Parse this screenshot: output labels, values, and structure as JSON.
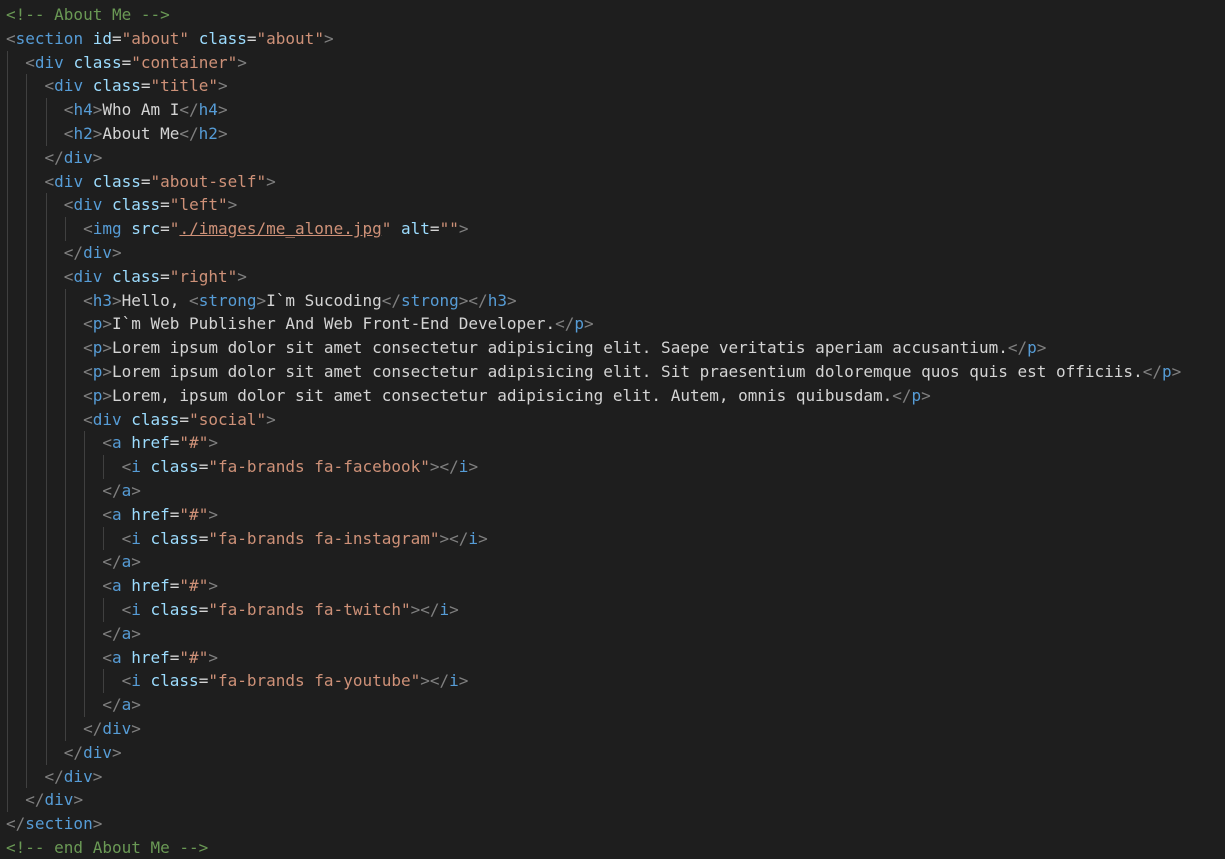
{
  "colors": {
    "background": "#1e1e1e",
    "comment": "#6a9955",
    "bracket": "#808080",
    "tag": "#569cd6",
    "attribute": "#9cdcfe",
    "string": "#ce9178",
    "text": "#d4d4d4",
    "indent_guide": "#404040"
  },
  "editor": {
    "indent_chars": 2,
    "lines": [
      {
        "indent": 0,
        "tokens": [
          {
            "t": "c",
            "v": "<!-- About Me -->"
          }
        ]
      },
      {
        "indent": 0,
        "tokens": [
          {
            "t": "b",
            "v": "<"
          },
          {
            "t": "g",
            "v": "section"
          },
          {
            "t": "x",
            "v": " "
          },
          {
            "t": "a",
            "v": "id"
          },
          {
            "t": "x",
            "v": "="
          },
          {
            "t": "s",
            "v": "\"about\""
          },
          {
            "t": "x",
            "v": " "
          },
          {
            "t": "a",
            "v": "class"
          },
          {
            "t": "x",
            "v": "="
          },
          {
            "t": "s",
            "v": "\"about\""
          },
          {
            "t": "b",
            "v": ">"
          }
        ]
      },
      {
        "indent": 1,
        "tokens": [
          {
            "t": "b",
            "v": "<"
          },
          {
            "t": "g",
            "v": "div"
          },
          {
            "t": "x",
            "v": " "
          },
          {
            "t": "a",
            "v": "class"
          },
          {
            "t": "x",
            "v": "="
          },
          {
            "t": "s",
            "v": "\"container\""
          },
          {
            "t": "b",
            "v": ">"
          }
        ]
      },
      {
        "indent": 2,
        "tokens": [
          {
            "t": "b",
            "v": "<"
          },
          {
            "t": "g",
            "v": "div"
          },
          {
            "t": "x",
            "v": " "
          },
          {
            "t": "a",
            "v": "class"
          },
          {
            "t": "x",
            "v": "="
          },
          {
            "t": "s",
            "v": "\"title\""
          },
          {
            "t": "b",
            "v": ">"
          }
        ]
      },
      {
        "indent": 3,
        "tokens": [
          {
            "t": "b",
            "v": "<"
          },
          {
            "t": "g",
            "v": "h4"
          },
          {
            "t": "b",
            "v": ">"
          },
          {
            "t": "x",
            "v": "Who Am I"
          },
          {
            "t": "b",
            "v": "</"
          },
          {
            "t": "g",
            "v": "h4"
          },
          {
            "t": "b",
            "v": ">"
          }
        ]
      },
      {
        "indent": 3,
        "tokens": [
          {
            "t": "b",
            "v": "<"
          },
          {
            "t": "g",
            "v": "h2"
          },
          {
            "t": "b",
            "v": ">"
          },
          {
            "t": "x",
            "v": "About Me"
          },
          {
            "t": "b",
            "v": "</"
          },
          {
            "t": "g",
            "v": "h2"
          },
          {
            "t": "b",
            "v": ">"
          }
        ]
      },
      {
        "indent": 2,
        "tokens": [
          {
            "t": "b",
            "v": "</"
          },
          {
            "t": "g",
            "v": "div"
          },
          {
            "t": "b",
            "v": ">"
          }
        ]
      },
      {
        "indent": 2,
        "tokens": [
          {
            "t": "b",
            "v": "<"
          },
          {
            "t": "g",
            "v": "div"
          },
          {
            "t": "x",
            "v": " "
          },
          {
            "t": "a",
            "v": "class"
          },
          {
            "t": "x",
            "v": "="
          },
          {
            "t": "s",
            "v": "\"about-self\""
          },
          {
            "t": "b",
            "v": ">"
          }
        ]
      },
      {
        "indent": 3,
        "tokens": [
          {
            "t": "b",
            "v": "<"
          },
          {
            "t": "g",
            "v": "div"
          },
          {
            "t": "x",
            "v": " "
          },
          {
            "t": "a",
            "v": "class"
          },
          {
            "t": "x",
            "v": "="
          },
          {
            "t": "s",
            "v": "\"left\""
          },
          {
            "t": "b",
            "v": ">"
          }
        ]
      },
      {
        "indent": 4,
        "tokens": [
          {
            "t": "b",
            "v": "<"
          },
          {
            "t": "g",
            "v": "img"
          },
          {
            "t": "x",
            "v": " "
          },
          {
            "t": "a",
            "v": "src"
          },
          {
            "t": "x",
            "v": "="
          },
          {
            "t": "s",
            "v": "\""
          },
          {
            "t": "u",
            "v": "./images/me_alone.jpg"
          },
          {
            "t": "s",
            "v": "\""
          },
          {
            "t": "x",
            "v": " "
          },
          {
            "t": "a",
            "v": "alt"
          },
          {
            "t": "x",
            "v": "="
          },
          {
            "t": "s",
            "v": "\"\""
          },
          {
            "t": "b",
            "v": ">"
          }
        ]
      },
      {
        "indent": 3,
        "tokens": [
          {
            "t": "b",
            "v": "</"
          },
          {
            "t": "g",
            "v": "div"
          },
          {
            "t": "b",
            "v": ">"
          }
        ]
      },
      {
        "indent": 3,
        "tokens": [
          {
            "t": "b",
            "v": "<"
          },
          {
            "t": "g",
            "v": "div"
          },
          {
            "t": "x",
            "v": " "
          },
          {
            "t": "a",
            "v": "class"
          },
          {
            "t": "x",
            "v": "="
          },
          {
            "t": "s",
            "v": "\"right\""
          },
          {
            "t": "b",
            "v": ">"
          }
        ]
      },
      {
        "indent": 4,
        "tokens": [
          {
            "t": "b",
            "v": "<"
          },
          {
            "t": "g",
            "v": "h3"
          },
          {
            "t": "b",
            "v": ">"
          },
          {
            "t": "x",
            "v": "Hello, "
          },
          {
            "t": "b",
            "v": "<"
          },
          {
            "t": "g",
            "v": "strong"
          },
          {
            "t": "b",
            "v": ">"
          },
          {
            "t": "x",
            "v": "I`m Sucoding"
          },
          {
            "t": "b",
            "v": "</"
          },
          {
            "t": "g",
            "v": "strong"
          },
          {
            "t": "b",
            "v": "></"
          },
          {
            "t": "g",
            "v": "h3"
          },
          {
            "t": "b",
            "v": ">"
          }
        ]
      },
      {
        "indent": 4,
        "tokens": [
          {
            "t": "b",
            "v": "<"
          },
          {
            "t": "g",
            "v": "p"
          },
          {
            "t": "b",
            "v": ">"
          },
          {
            "t": "x",
            "v": "I`m Web Publisher And Web Front-End Developer."
          },
          {
            "t": "b",
            "v": "</"
          },
          {
            "t": "g",
            "v": "p"
          },
          {
            "t": "b",
            "v": ">"
          }
        ]
      },
      {
        "indent": 4,
        "tokens": [
          {
            "t": "b",
            "v": "<"
          },
          {
            "t": "g",
            "v": "p"
          },
          {
            "t": "b",
            "v": ">"
          },
          {
            "t": "x",
            "v": "Lorem ipsum dolor sit amet consectetur adipisicing elit. Saepe veritatis aperiam accusantium."
          },
          {
            "t": "b",
            "v": "</"
          },
          {
            "t": "g",
            "v": "p"
          },
          {
            "t": "b",
            "v": ">"
          }
        ]
      },
      {
        "indent": 4,
        "tokens": [
          {
            "t": "b",
            "v": "<"
          },
          {
            "t": "g",
            "v": "p"
          },
          {
            "t": "b",
            "v": ">"
          },
          {
            "t": "x",
            "v": "Lorem ipsum dolor sit amet consectetur adipisicing elit. Sit praesentium doloremque quos quis est officiis."
          },
          {
            "t": "b",
            "v": "</"
          },
          {
            "t": "g",
            "v": "p"
          },
          {
            "t": "b",
            "v": ">"
          }
        ]
      },
      {
        "indent": 4,
        "tokens": [
          {
            "t": "b",
            "v": "<"
          },
          {
            "t": "g",
            "v": "p"
          },
          {
            "t": "b",
            "v": ">"
          },
          {
            "t": "x",
            "v": "Lorem, ipsum dolor sit amet consectetur adipisicing elit. Autem, omnis quibusdam."
          },
          {
            "t": "b",
            "v": "</"
          },
          {
            "t": "g",
            "v": "p"
          },
          {
            "t": "b",
            "v": ">"
          }
        ]
      },
      {
        "indent": 4,
        "tokens": [
          {
            "t": "b",
            "v": "<"
          },
          {
            "t": "g",
            "v": "div"
          },
          {
            "t": "x",
            "v": " "
          },
          {
            "t": "a",
            "v": "class"
          },
          {
            "t": "x",
            "v": "="
          },
          {
            "t": "s",
            "v": "\"social\""
          },
          {
            "t": "b",
            "v": ">"
          }
        ]
      },
      {
        "indent": 5,
        "tokens": [
          {
            "t": "b",
            "v": "<"
          },
          {
            "t": "g",
            "v": "a"
          },
          {
            "t": "x",
            "v": " "
          },
          {
            "t": "a",
            "v": "href"
          },
          {
            "t": "x",
            "v": "="
          },
          {
            "t": "s",
            "v": "\"#\""
          },
          {
            "t": "b",
            "v": ">"
          }
        ]
      },
      {
        "indent": 6,
        "tokens": [
          {
            "t": "b",
            "v": "<"
          },
          {
            "t": "g",
            "v": "i"
          },
          {
            "t": "x",
            "v": " "
          },
          {
            "t": "a",
            "v": "class"
          },
          {
            "t": "x",
            "v": "="
          },
          {
            "t": "s",
            "v": "\"fa-brands fa-facebook\""
          },
          {
            "t": "b",
            "v": "></"
          },
          {
            "t": "g",
            "v": "i"
          },
          {
            "t": "b",
            "v": ">"
          }
        ]
      },
      {
        "indent": 5,
        "tokens": [
          {
            "t": "b",
            "v": "</"
          },
          {
            "t": "g",
            "v": "a"
          },
          {
            "t": "b",
            "v": ">"
          }
        ]
      },
      {
        "indent": 5,
        "tokens": [
          {
            "t": "b",
            "v": "<"
          },
          {
            "t": "g",
            "v": "a"
          },
          {
            "t": "x",
            "v": " "
          },
          {
            "t": "a",
            "v": "href"
          },
          {
            "t": "x",
            "v": "="
          },
          {
            "t": "s",
            "v": "\"#\""
          },
          {
            "t": "b",
            "v": ">"
          }
        ]
      },
      {
        "indent": 6,
        "tokens": [
          {
            "t": "b",
            "v": "<"
          },
          {
            "t": "g",
            "v": "i"
          },
          {
            "t": "x",
            "v": " "
          },
          {
            "t": "a",
            "v": "class"
          },
          {
            "t": "x",
            "v": "="
          },
          {
            "t": "s",
            "v": "\"fa-brands fa-instagram\""
          },
          {
            "t": "b",
            "v": "></"
          },
          {
            "t": "g",
            "v": "i"
          },
          {
            "t": "b",
            "v": ">"
          }
        ]
      },
      {
        "indent": 5,
        "tokens": [
          {
            "t": "b",
            "v": "</"
          },
          {
            "t": "g",
            "v": "a"
          },
          {
            "t": "b",
            "v": ">"
          }
        ]
      },
      {
        "indent": 5,
        "tokens": [
          {
            "t": "b",
            "v": "<"
          },
          {
            "t": "g",
            "v": "a"
          },
          {
            "t": "x",
            "v": " "
          },
          {
            "t": "a",
            "v": "href"
          },
          {
            "t": "x",
            "v": "="
          },
          {
            "t": "s",
            "v": "\"#\""
          },
          {
            "t": "b",
            "v": ">"
          }
        ]
      },
      {
        "indent": 6,
        "tokens": [
          {
            "t": "b",
            "v": "<"
          },
          {
            "t": "g",
            "v": "i"
          },
          {
            "t": "x",
            "v": " "
          },
          {
            "t": "a",
            "v": "class"
          },
          {
            "t": "x",
            "v": "="
          },
          {
            "t": "s",
            "v": "\"fa-brands fa-twitch\""
          },
          {
            "t": "b",
            "v": "></"
          },
          {
            "t": "g",
            "v": "i"
          },
          {
            "t": "b",
            "v": ">"
          }
        ]
      },
      {
        "indent": 5,
        "tokens": [
          {
            "t": "b",
            "v": "</"
          },
          {
            "t": "g",
            "v": "a"
          },
          {
            "t": "b",
            "v": ">"
          }
        ]
      },
      {
        "indent": 5,
        "tokens": [
          {
            "t": "b",
            "v": "<"
          },
          {
            "t": "g",
            "v": "a"
          },
          {
            "t": "x",
            "v": " "
          },
          {
            "t": "a",
            "v": "href"
          },
          {
            "t": "x",
            "v": "="
          },
          {
            "t": "s",
            "v": "\"#\""
          },
          {
            "t": "b",
            "v": ">"
          }
        ]
      },
      {
        "indent": 6,
        "tokens": [
          {
            "t": "b",
            "v": "<"
          },
          {
            "t": "g",
            "v": "i"
          },
          {
            "t": "x",
            "v": " "
          },
          {
            "t": "a",
            "v": "class"
          },
          {
            "t": "x",
            "v": "="
          },
          {
            "t": "s",
            "v": "\"fa-brands fa-youtube\""
          },
          {
            "t": "b",
            "v": "></"
          },
          {
            "t": "g",
            "v": "i"
          },
          {
            "t": "b",
            "v": ">"
          }
        ]
      },
      {
        "indent": 5,
        "tokens": [
          {
            "t": "b",
            "v": "</"
          },
          {
            "t": "g",
            "v": "a"
          },
          {
            "t": "b",
            "v": ">"
          }
        ]
      },
      {
        "indent": 4,
        "tokens": [
          {
            "t": "b",
            "v": "</"
          },
          {
            "t": "g",
            "v": "div"
          },
          {
            "t": "b",
            "v": ">"
          }
        ]
      },
      {
        "indent": 3,
        "tokens": [
          {
            "t": "b",
            "v": "</"
          },
          {
            "t": "g",
            "v": "div"
          },
          {
            "t": "b",
            "v": ">"
          }
        ]
      },
      {
        "indent": 2,
        "tokens": [
          {
            "t": "b",
            "v": "</"
          },
          {
            "t": "g",
            "v": "div"
          },
          {
            "t": "b",
            "v": ">"
          }
        ]
      },
      {
        "indent": 1,
        "tokens": [
          {
            "t": "b",
            "v": "</"
          },
          {
            "t": "g",
            "v": "div"
          },
          {
            "t": "b",
            "v": ">"
          }
        ]
      },
      {
        "indent": 0,
        "tokens": [
          {
            "t": "b",
            "v": "</"
          },
          {
            "t": "g",
            "v": "section"
          },
          {
            "t": "b",
            "v": ">"
          }
        ]
      },
      {
        "indent": 0,
        "tokens": [
          {
            "t": "c",
            "v": "<!-- end About Me -->"
          }
        ]
      }
    ]
  }
}
